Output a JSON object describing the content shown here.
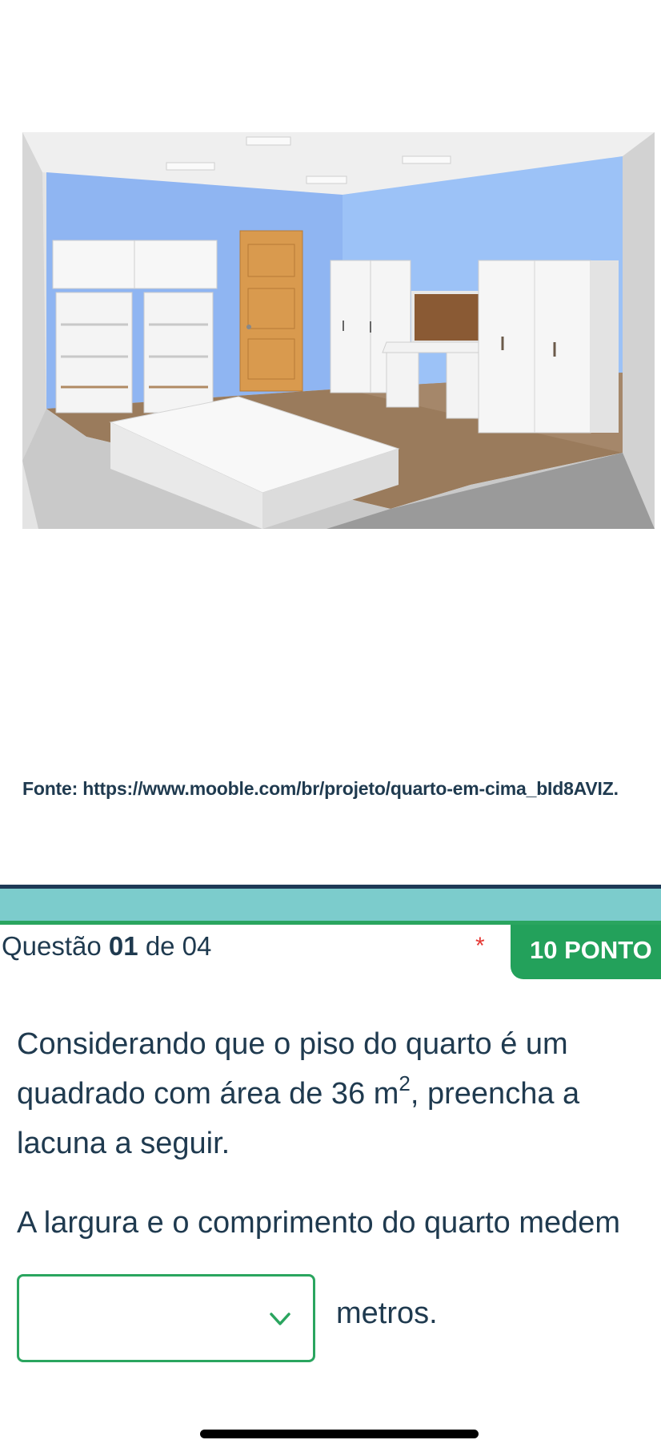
{
  "figure": {
    "source_caption": "Fonte: https://www.mooble.com/br/projeto/quarto-em-cima_bId8AVIZ."
  },
  "question": {
    "prefix": "Questão",
    "number": "01",
    "of_label": "de 04",
    "required_mark": "*",
    "points": "10 PONTO",
    "text_before_sup": "Considerando que o piso do quarto é um quadrado com área de 36 m",
    "sup": "2",
    "text_after_sup": ", preencha a lacuna a seguir.",
    "prompt": "A largura e o comprimento do quarto medem",
    "answer_value": "",
    "unit": "metros."
  },
  "icons": {
    "select_chevron": "chevron-down-icon"
  },
  "colors": {
    "accent_green": "#23a15b",
    "teal_bar": "#7ccccc",
    "navy": "#1e3a56",
    "text": "#1f3a4f",
    "required": "#e53935"
  }
}
